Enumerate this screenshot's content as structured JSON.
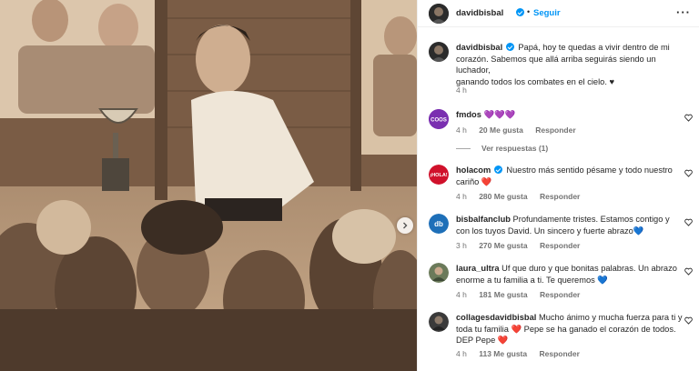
{
  "header": {
    "username": "davidbisbal",
    "separator": "•",
    "follow_label": "Seguir",
    "more_icon": "more-horizontal-icon"
  },
  "caption": {
    "username": "davidbisbal",
    "text_line1": "Papá, hoy te quedas a vivir dentro de mi corazón. Sabemos que allá arriba seguirás siendo un luchador,",
    "text_line2": "ganando todos los combates en el cielo. ♥",
    "time": "4 h"
  },
  "comments": [
    {
      "username": "fmdos",
      "verified": false,
      "text": "💜💜💜",
      "time": "4 h",
      "likes": "20 Me gusta",
      "reply": "Responder",
      "avatar_label": "COOS",
      "avatar_color": "#7a2fb0"
    },
    {
      "username": "holacom",
      "verified": true,
      "text": "Nuestro más sentido pésame y todo nuestro cariño ❤️",
      "time": "4 h",
      "likes": "280 Me gusta",
      "reply": "Responder",
      "avatar_label": "¡HOLA!",
      "avatar_color": "#d0112b"
    },
    {
      "username": "bisbalfanclub",
      "verified": false,
      "text": "Profundamente tristes. Estamos contigo y con los tuyos David. Un sincero y fuerte abrazo💙",
      "time": "3 h",
      "likes": "270 Me gusta",
      "reply": "Responder",
      "avatar_label": "db",
      "avatar_color": "#1e6fb8"
    },
    {
      "username": "laura_ultra",
      "verified": false,
      "text": "Uf que duro y que bonitas palabras. Un abrazo enorme a tu familia a ti. Te queremos 💙",
      "time": "4 h",
      "likes": "181 Me gusta",
      "reply": "Responder",
      "avatar_label": "",
      "avatar_color": "#6b7a5a"
    },
    {
      "username": "collagesdavidbisbal",
      "verified": false,
      "text": "Mucho ánimo y mucha fuerza para ti y toda tu familia ❤️ Pepe se ha ganado el corazón de todos. DEP Pepe ❤️",
      "time": "4 h",
      "likes": "113 Me gusta",
      "reply": "Responder",
      "avatar_label": "",
      "avatar_color": "#3a3a3a"
    }
  ],
  "view_replies": "Ver respuestas (1)",
  "photo": {
    "next_icon": "chevron-right-icon"
  },
  "colors": {
    "accent": "#0095f6",
    "muted": "#737373",
    "text": "#262626"
  }
}
